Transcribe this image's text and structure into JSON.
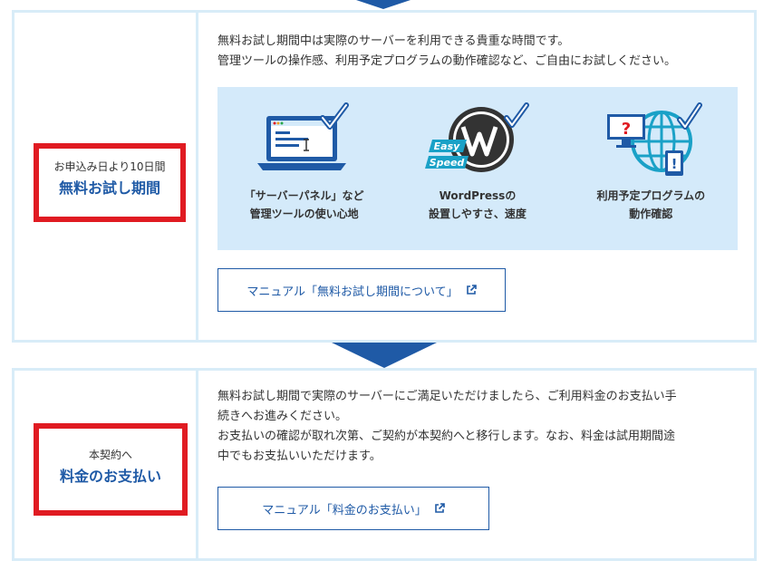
{
  "trial": {
    "label_small": "お申込み日より10日間",
    "label_big": "無料お試し期間",
    "desc_line1": "無料お試し期間中は実際のサーバーを利用できる貴重な時間です。",
    "desc_line2": "管理ツールの操作感、利用予定プログラムの動作確認など、ご自由にお試しください。",
    "features": [
      {
        "line1": "「サーバーパネル」など",
        "line2": "管理ツールの使い心地",
        "icon": "laptop-check-icon"
      },
      {
        "line1": "WordPressの",
        "line2": "設置しやすさ、速度",
        "icon": "wordpress-check-icon",
        "badge1": "Easy",
        "badge2": "Speed"
      },
      {
        "line1": "利用予定プログラムの",
        "line2": "動作確認",
        "icon": "globe-check-icon",
        "mark1": "?",
        "mark2": "!"
      }
    ],
    "manual_label": "マニュアル「無料お試し期間について」"
  },
  "payment": {
    "label_small": "本契約へ",
    "label_big": "料金のお支払い",
    "desc_line1": "無料お試し期間で実際のサーバーにご満足いただけましたら、ご利用料金のお支払い手",
    "desc_line2": "続きへお進みください。",
    "desc_line3": "お支払いの確認が取れ次第、ご契約が本契約へと移行します。なお、料金は試用期間途",
    "desc_line4": "中でもお支払いいただけます。",
    "manual_label": "マニュアル「料金のお支払い」"
  },
  "colors": {
    "accent": "#1f5aa6",
    "highlight_border": "#e01b22",
    "panel_border": "#d8ecf8",
    "feature_bg": "#d4eafa",
    "teal": "#1aa1c7"
  }
}
